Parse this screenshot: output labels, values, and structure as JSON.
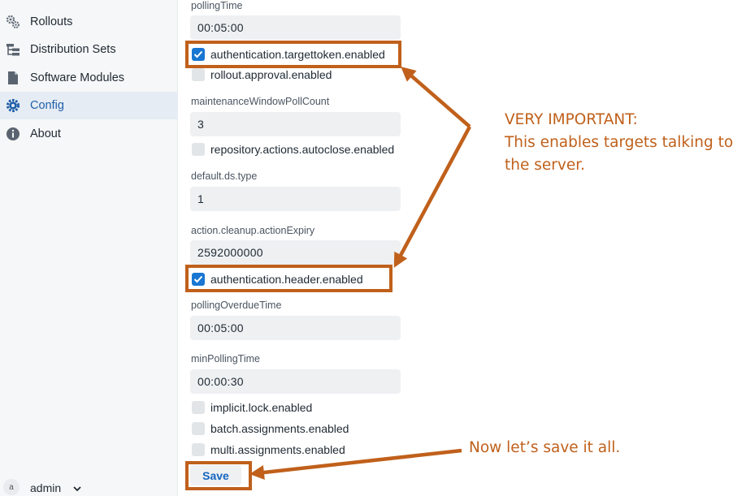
{
  "sidebar": {
    "items": [
      {
        "label": "Rollouts",
        "icon": "gears-icon",
        "active": false
      },
      {
        "label": "Distribution Sets",
        "icon": "hierarchy-icon",
        "active": false
      },
      {
        "label": "Software Modules",
        "icon": "file-icon",
        "active": false
      },
      {
        "label": "Config",
        "icon": "gear-icon",
        "active": true
      },
      {
        "label": "About",
        "icon": "info-icon",
        "active": false
      }
    ],
    "user": {
      "avatar": "a",
      "name": "admin"
    }
  },
  "form": {
    "fields": {
      "pollingTime": {
        "label": "pollingTime",
        "value": "00:05:00"
      },
      "maintenanceWindowPollCount": {
        "label": "maintenanceWindowPollCount",
        "value": "3"
      },
      "defaultDsType": {
        "label": "default.ds.type",
        "value": "1"
      },
      "actionCleanupExpiry": {
        "label": "action.cleanup.actionExpiry",
        "value": "2592000000"
      },
      "pollingOverdueTime": {
        "label": "pollingOverdueTime",
        "value": "00:05:00"
      },
      "minPollingTime": {
        "label": "minPollingTime",
        "value": "00:00:30"
      }
    },
    "checkboxes": {
      "targettoken": {
        "label": "authentication.targettoken.enabled",
        "checked": true
      },
      "rolloutApproval": {
        "label": "rollout.approval.enabled",
        "checked": false
      },
      "autoclose": {
        "label": "repository.actions.autoclose.enabled",
        "checked": false
      },
      "header": {
        "label": "authentication.header.enabled",
        "checked": true
      },
      "implicitLock": {
        "label": "implicit.lock.enabled",
        "checked": false
      },
      "batchAssignments": {
        "label": "batch.assignments.enabled",
        "checked": false
      },
      "multiAssignments": {
        "label": "multi.assignments.enabled",
        "checked": false
      }
    },
    "save_label": "Save"
  },
  "annotations": {
    "important_line1": "VERY IMPORTANT:",
    "important_line2": "This enables targets talking to",
    "important_line3": "the server.",
    "save_note": "Now let’s save it all.",
    "color": "#c0601b"
  },
  "colors": {
    "accent": "#1976d2",
    "active_nav_bg": "#e6ecf4"
  }
}
